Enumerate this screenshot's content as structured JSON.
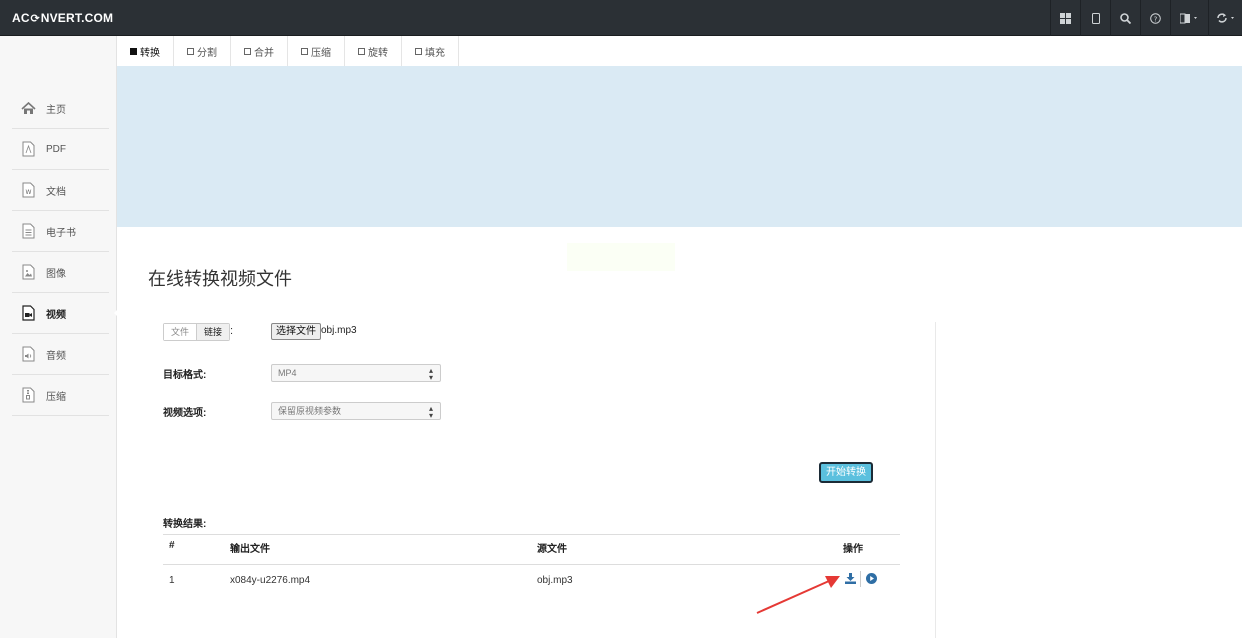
{
  "brand": {
    "left": "AC",
    "icon": "refresh-icon",
    "right": "NVERT.COM"
  },
  "topbar_icons": [
    "grid-icon",
    "tablet-icon",
    "search-icon",
    "help-icon",
    "language-icon",
    "sync-icon"
  ],
  "sidebar": {
    "items": [
      {
        "label": "主页",
        "icon": "home-icon",
        "active": false
      },
      {
        "label": "PDF",
        "icon": "pdf-file-icon",
        "active": false
      },
      {
        "label": "文档",
        "icon": "word-file-icon",
        "active": false
      },
      {
        "label": "电子书",
        "icon": "ebook-file-icon",
        "active": false
      },
      {
        "label": "图像",
        "icon": "image-file-icon",
        "active": false
      },
      {
        "label": "视频",
        "icon": "video-file-icon",
        "active": true
      },
      {
        "label": "音频",
        "icon": "audio-file-icon",
        "active": false
      },
      {
        "label": "压缩",
        "icon": "archive-file-icon",
        "active": false
      }
    ]
  },
  "tabs": [
    {
      "label": "转换",
      "active": true
    },
    {
      "label": "分割",
      "active": false
    },
    {
      "label": "合并",
      "active": false
    },
    {
      "label": "压缩",
      "active": false
    },
    {
      "label": "旋转",
      "active": false
    },
    {
      "label": "填充",
      "active": false
    }
  ],
  "main": {
    "title": "在线转换视频文件",
    "source_toggle": {
      "file": "文件",
      "link": "链接",
      "colon": ":"
    },
    "choose_file_label": "选择文件",
    "file_name": "obj.mp3",
    "target_format_label": "目标格式:",
    "target_format_value": "MP4",
    "video_options_label": "视频选项:",
    "video_options_value": "保留原视频参数",
    "start_button": "开始转换"
  },
  "results": {
    "label": "转换结果:",
    "columns": [
      "#",
      "输出文件",
      "源文件",
      "操作"
    ],
    "rows": [
      {
        "index": "1",
        "output": "x084y-u2276.mp4",
        "source": "obj.mp3"
      }
    ]
  },
  "colors": {
    "topbar": "#2b3035",
    "banner": "#daeaf4",
    "accent": "#5bc0de",
    "link": "#337ab7",
    "annotation_arrow": "#e53935"
  }
}
